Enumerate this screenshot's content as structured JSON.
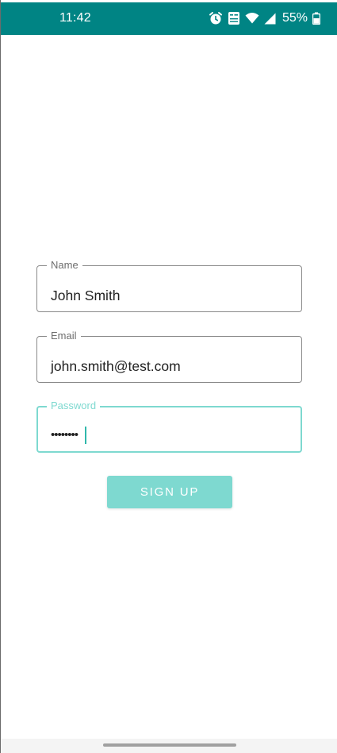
{
  "status_bar": {
    "time": "11:42",
    "battery_percent": "55%",
    "icons": [
      "alarm-icon",
      "volte-icon",
      "wifi-icon",
      "cell-signal-icon",
      "battery-icon"
    ],
    "background_color": "#008484"
  },
  "form": {
    "name": {
      "label": "Name",
      "value": "John Smith"
    },
    "email": {
      "label": "Email",
      "value": "john.smith@test.com"
    },
    "password": {
      "label": "Password",
      "value": "••••••••"
    }
  },
  "signup_button": {
    "label": "SIGN UP"
  },
  "colors": {
    "accent": "#7ed9d0",
    "outline": "#8a8a8a"
  }
}
